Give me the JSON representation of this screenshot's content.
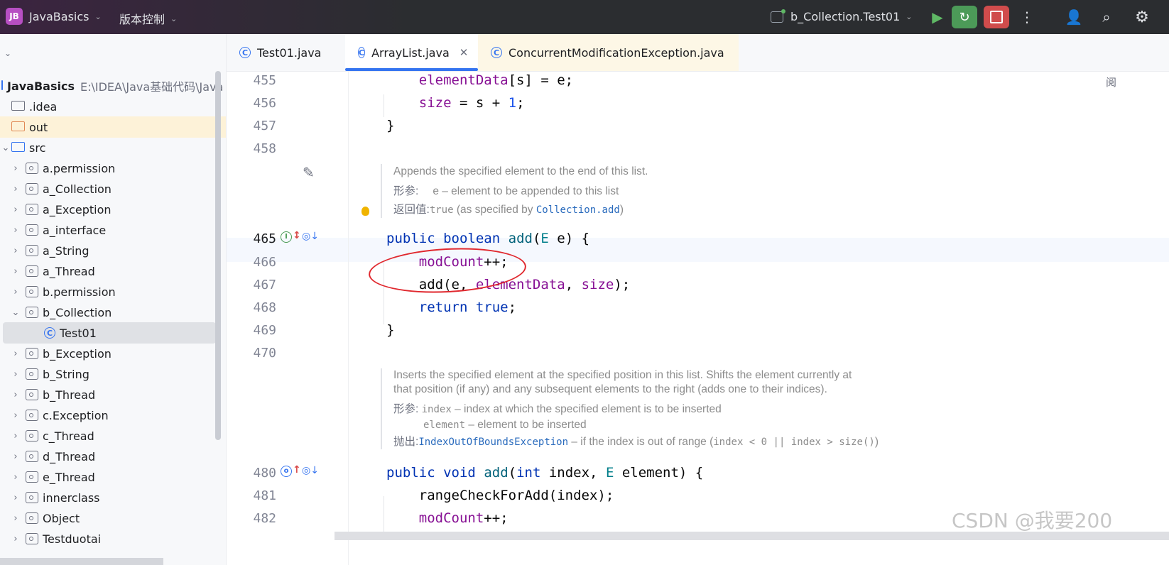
{
  "titlebar": {
    "logo": "JB",
    "project": "JavaBasics",
    "vcs": "版本控制",
    "run_config": "b_Collection.Test01",
    "icons": [
      "run-icon",
      "debug-icon",
      "stop-icon",
      "more-icon",
      "user-icon",
      "search-icon",
      "gear-icon"
    ]
  },
  "project_tree": {
    "root": {
      "name": "JavaBasics",
      "path": "E:\\IDEA\\Java基础代码\\Java"
    },
    "items": [
      {
        "label": ".idea"
      },
      {
        "label": "out"
      },
      {
        "label": "src"
      },
      {
        "label": "a.permission"
      },
      {
        "label": "a_Collection"
      },
      {
        "label": "a_Exception"
      },
      {
        "label": "a_interface"
      },
      {
        "label": "a_String"
      },
      {
        "label": "a_Thread"
      },
      {
        "label": "b.permission"
      },
      {
        "label": "b_Collection"
      },
      {
        "label": "Test01"
      },
      {
        "label": "b_Exception"
      },
      {
        "label": "b_String"
      },
      {
        "label": "b_Thread"
      },
      {
        "label": "c.Exception"
      },
      {
        "label": "c_Thread"
      },
      {
        "label": "d_Thread"
      },
      {
        "label": "e_Thread"
      },
      {
        "label": "innerclass"
      },
      {
        "label": "Object"
      },
      {
        "label": "Testduotai"
      }
    ]
  },
  "tabs": [
    {
      "label": "Test01.java"
    },
    {
      "label": "ArrayList.java"
    },
    {
      "label": "ConcurrentModificationException.java"
    }
  ],
  "editor": {
    "line_numbers": [
      "455",
      "456",
      "457",
      "458",
      "465",
      "466",
      "467",
      "468",
      "469",
      "470",
      "480",
      "481",
      "482"
    ],
    "doc1": {
      "summary": "Appends the specified element to the end of this list.",
      "param_label": "形参:",
      "param_text": "e – element to be appended to this list",
      "return_label": "返回值:",
      "return_code": "true",
      "return_mid": " (as specified by ",
      "return_link": "Collection.add",
      "return_end": ")"
    },
    "doc2": {
      "summary1": "Inserts the specified element at the specified position in this list. Shifts the element currently at",
      "summary2": "that position (if any) and any subsequent elements to the right (adds one to their indices).",
      "param_label": "形参:",
      "p1_code": "index",
      "p1_text": " – index at which the specified element is to be inserted",
      "p2_code": "element",
      "p2_text": " – element to be inserted",
      "throws_label": "抛出:",
      "throws_link": "IndexOutOfBoundsException",
      "throws_text": " – if the index is out of range (",
      "throws_code": "index < 0 || index > size()",
      "throws_end": ")"
    },
    "right_hint": "阅"
  },
  "watermark": "CSDN @我要200"
}
